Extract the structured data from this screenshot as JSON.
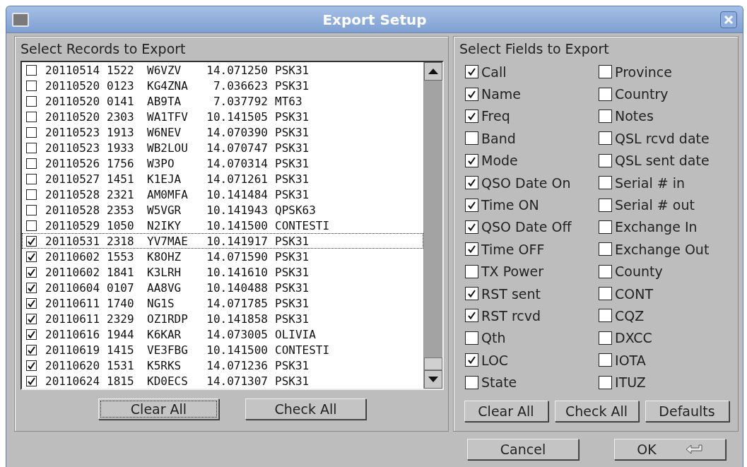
{
  "window": {
    "title": "Export Setup"
  },
  "records": {
    "title": "Select Records to Export",
    "rows": [
      {
        "date": "20110514",
        "time": "1522",
        "call": "W6VZV",
        "freq": "14.071250",
        "mode": "PSK31",
        "checked": false,
        "focused": false
      },
      {
        "date": "20110520",
        "time": "0123",
        "call": "KG4ZNA",
        "freq": "7.036623",
        "mode": "PSK31",
        "checked": false,
        "focused": false
      },
      {
        "date": "20110520",
        "time": "0141",
        "call": "AB9TA",
        "freq": "7.037792",
        "mode": "MT63",
        "checked": false,
        "focused": false
      },
      {
        "date": "20110520",
        "time": "2303",
        "call": "WA1TFV",
        "freq": "10.141505",
        "mode": "PSK31",
        "checked": false,
        "focused": false
      },
      {
        "date": "20110523",
        "time": "1913",
        "call": "W6NEV",
        "freq": "14.070390",
        "mode": "PSK31",
        "checked": false,
        "focused": false
      },
      {
        "date": "20110523",
        "time": "1933",
        "call": "WB2LOU",
        "freq": "14.070747",
        "mode": "PSK31",
        "checked": false,
        "focused": false
      },
      {
        "date": "20110526",
        "time": "1756",
        "call": "W3PO",
        "freq": "14.070314",
        "mode": "PSK31",
        "checked": false,
        "focused": false
      },
      {
        "date": "20110527",
        "time": "1451",
        "call": "K1EJA",
        "freq": "14.071261",
        "mode": "PSK31",
        "checked": false,
        "focused": false
      },
      {
        "date": "20110528",
        "time": "2321",
        "call": "AM0MFA",
        "freq": "10.141484",
        "mode": "PSK31",
        "checked": false,
        "focused": false
      },
      {
        "date": "20110528",
        "time": "2353",
        "call": "W5VGR",
        "freq": "10.141943",
        "mode": "QPSK63",
        "checked": false,
        "focused": false
      },
      {
        "date": "20110529",
        "time": "1050",
        "call": "N2IKY",
        "freq": "10.141500",
        "mode": "CONTESTI",
        "checked": false,
        "focused": false
      },
      {
        "date": "20110531",
        "time": "2318",
        "call": "YV7MAE",
        "freq": "10.141917",
        "mode": "PSK31",
        "checked": true,
        "focused": true
      },
      {
        "date": "20110602",
        "time": "1553",
        "call": "K8OHZ",
        "freq": "14.071590",
        "mode": "PSK31",
        "checked": true,
        "focused": false
      },
      {
        "date": "20110602",
        "time": "1841",
        "call": "K3LRH",
        "freq": "10.141610",
        "mode": "PSK31",
        "checked": true,
        "focused": false
      },
      {
        "date": "20110604",
        "time": "0107",
        "call": "AA8VG",
        "freq": "10.140488",
        "mode": "PSK31",
        "checked": true,
        "focused": false
      },
      {
        "date": "20110611",
        "time": "1740",
        "call": "NG1S",
        "freq": "14.071785",
        "mode": "PSK31",
        "checked": true,
        "focused": false
      },
      {
        "date": "20110611",
        "time": "2329",
        "call": "OZ1RDP",
        "freq": "10.141858",
        "mode": "PSK31",
        "checked": true,
        "focused": false
      },
      {
        "date": "20110616",
        "time": "1944",
        "call": "K6KAR",
        "freq": "14.073005",
        "mode": "OLIVIA",
        "checked": true,
        "focused": false
      },
      {
        "date": "20110619",
        "time": "1415",
        "call": "VE3FBG",
        "freq": "10.141500",
        "mode": "CONTESTI",
        "checked": true,
        "focused": false
      },
      {
        "date": "20110620",
        "time": "1531",
        "call": "K5RKS",
        "freq": "14.071236",
        "mode": "PSK31",
        "checked": true,
        "focused": false
      },
      {
        "date": "20110624",
        "time": "1815",
        "call": "KD0ECS",
        "freq": "14.071307",
        "mode": "PSK31",
        "checked": true,
        "focused": false
      }
    ],
    "buttons": [
      {
        "label": "Clear All",
        "focused": true
      },
      {
        "label": "Check All",
        "focused": false
      }
    ]
  },
  "fields": {
    "title": "Select Fields to Export",
    "columns": [
      [
        {
          "label": "Call",
          "checked": true
        },
        {
          "label": "Name",
          "checked": true
        },
        {
          "label": "Freq",
          "checked": true
        },
        {
          "label": "Band",
          "checked": false
        },
        {
          "label": "Mode",
          "checked": true
        },
        {
          "label": "QSO Date On",
          "checked": true
        },
        {
          "label": "Time ON",
          "checked": true
        },
        {
          "label": "QSO Date Off",
          "checked": true
        },
        {
          "label": "Time OFF",
          "checked": true
        },
        {
          "label": "TX Power",
          "checked": false
        },
        {
          "label": "RST sent",
          "checked": true
        },
        {
          "label": "RST rcvd",
          "checked": true
        },
        {
          "label": "Qth",
          "checked": false
        },
        {
          "label": "LOC",
          "checked": true
        },
        {
          "label": "State",
          "checked": false
        }
      ],
      [
        {
          "label": "Province",
          "checked": false
        },
        {
          "label": "Country",
          "checked": false
        },
        {
          "label": "Notes",
          "checked": false
        },
        {
          "label": "QSL rcvd date",
          "checked": false
        },
        {
          "label": "QSL sent date",
          "checked": false
        },
        {
          "label": "Serial # in",
          "checked": false
        },
        {
          "label": "Serial # out",
          "checked": false
        },
        {
          "label": "Exchange In",
          "checked": false
        },
        {
          "label": "Exchange Out",
          "checked": false
        },
        {
          "label": "County",
          "checked": false
        },
        {
          "label": "CONT",
          "checked": false
        },
        {
          "label": "CQZ",
          "checked": false
        },
        {
          "label": "DXCC",
          "checked": false
        },
        {
          "label": "IOTA",
          "checked": false
        },
        {
          "label": "ITUZ",
          "checked": false
        }
      ]
    ],
    "buttons": [
      "Clear All",
      "Check All",
      "Defaults"
    ]
  },
  "dialog_buttons": [
    {
      "label": "Cancel",
      "kind": "plain"
    },
    {
      "label": "OK",
      "kind": "return"
    }
  ]
}
